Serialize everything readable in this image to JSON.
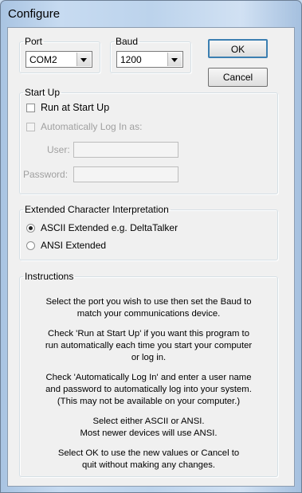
{
  "window": {
    "title": "Configure"
  },
  "port": {
    "label": "Port",
    "value": "COM2"
  },
  "baud": {
    "label": "Baud",
    "value": "1200"
  },
  "buttons": {
    "ok": "OK",
    "cancel": "Cancel"
  },
  "startup": {
    "label": "Start Up",
    "run_at_startup": "Run at Start Up",
    "auto_login": "Automatically Log In as:",
    "user_label": "User:",
    "password_label": "Password:",
    "user_value": "",
    "password_value": ""
  },
  "extended": {
    "label": "Extended Character Interpretation",
    "ascii": "ASCII Extended e.g. DeltaTalker",
    "ansi": "ANSI Extended"
  },
  "instructions": {
    "label": "Instructions",
    "p1": "Select the port you wish to use then set the Baud to\nmatch your communications device.",
    "p2": "Check 'Run at Start Up' if you want this program to\nrun automatically each time you start your computer\nor log in.",
    "p3": "Check 'Automatically Log In' and enter a user name\nand password to automatically log into your system.\n(This may not be available on your computer.)",
    "p4": "Select either ASCII or ANSI.\nMost newer devices will use ANSI.",
    "p5": "Select OK to use the new values or Cancel to\nquit without making any changes."
  }
}
